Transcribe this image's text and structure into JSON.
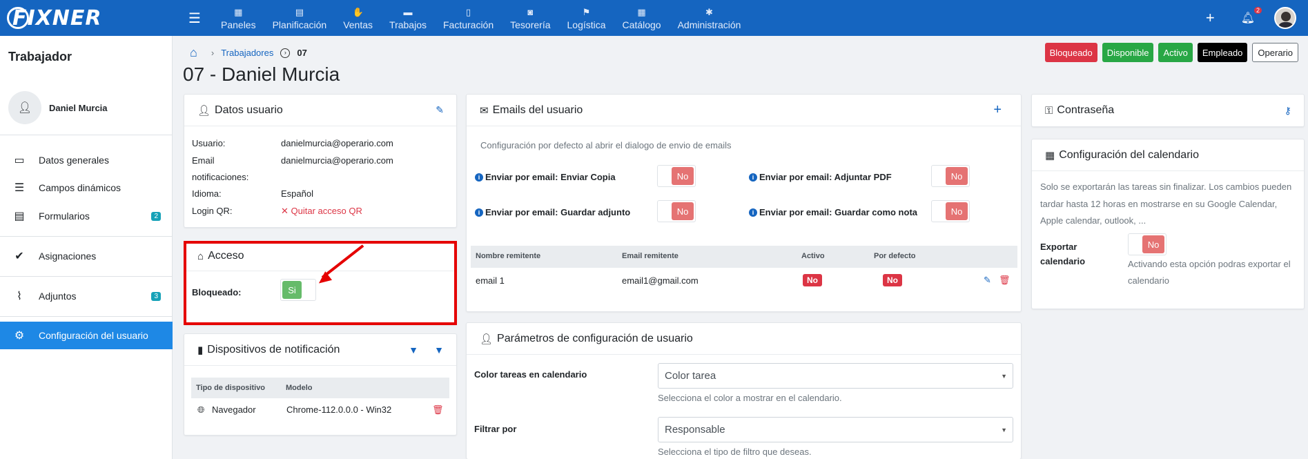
{
  "brand": {
    "logo": "FIXNER"
  },
  "nav": [
    {
      "label": "Paneles",
      "icon": "grid-icon",
      "glyph": "▦"
    },
    {
      "label": "Planificación",
      "icon": "calendar-icon",
      "glyph": "▤"
    },
    {
      "label": "Ventas",
      "icon": "handshake-icon",
      "glyph": "✋"
    },
    {
      "label": "Trabajos",
      "icon": "folder-icon",
      "glyph": "▬"
    },
    {
      "label": "Facturación",
      "icon": "invoice-icon",
      "glyph": "▯"
    },
    {
      "label": "Tesorería",
      "icon": "money-icon",
      "glyph": "◙"
    },
    {
      "label": "Logística",
      "icon": "truck-icon",
      "glyph": "⚑"
    },
    {
      "label": "Catálogo",
      "icon": "catalog-icon",
      "glyph": "▦"
    },
    {
      "label": "Administración",
      "icon": "cog-icon",
      "glyph": "✱"
    }
  ],
  "notifications": {
    "count": "2"
  },
  "sidebar": {
    "title": "Trabajador",
    "user_name": "Daniel Murcia",
    "items": [
      {
        "label": "Datos generales",
        "icon": "id-card-icon",
        "glyph": "▭"
      },
      {
        "label": "Campos dinámicos",
        "icon": "list-icon",
        "glyph": "☰"
      },
      {
        "label": "Formularios",
        "icon": "form-icon",
        "glyph": "▤",
        "badge": "2"
      },
      {
        "label": "Asignaciones",
        "icon": "user-check-icon",
        "glyph": "✔"
      },
      {
        "label": "Adjuntos",
        "icon": "paperclip-icon",
        "glyph": "⌇",
        "badge": "3"
      },
      {
        "label": "Configuración del usuario",
        "icon": "cogs-icon",
        "glyph": "⚙"
      }
    ]
  },
  "breadcrumb": {
    "link": "Trabajadores",
    "current": "07"
  },
  "page_title": "07 - Daniel Murcia",
  "status_buttons": [
    "Bloqueado",
    "Disponible",
    "Activo",
    "Empleado",
    "Operario"
  ],
  "datos_usuario": {
    "title": "Datos usuario",
    "rows": [
      {
        "label": "Usuario:",
        "value": "danielmurcia@operario.com"
      },
      {
        "label": "Email",
        "label2": "notificaciones:",
        "value": "danielmurcia@operario.com"
      },
      {
        "label": "Idioma:",
        "value": "Español"
      },
      {
        "label": "Login QR:",
        "value": "Quitar acceso QR"
      }
    ]
  },
  "acceso": {
    "title": "Acceso",
    "label": "Bloqueado:",
    "toggle": "Si"
  },
  "dispositivos": {
    "title": "Dispositivos de notificación",
    "columns": [
      "Tipo de dispositivo",
      "Modelo"
    ],
    "rows": [
      {
        "tipo": "Navegador",
        "modelo": "Chrome-112.0.0.0 - Win32"
      }
    ]
  },
  "emails": {
    "title": "Emails del usuario",
    "description": "Configuración por defecto al abrir el dialogo de envio de emails",
    "options": [
      {
        "label": "Enviar por email: Enviar Copia",
        "value": "No"
      },
      {
        "label": "Enviar por email: Adjuntar PDF",
        "value": "No"
      },
      {
        "label": "Enviar por email: Guardar adjunto",
        "value": "No"
      },
      {
        "label": "Enviar por email: Guardar como nota",
        "value": "No"
      }
    ],
    "columns": [
      "Nombre remitente",
      "Email remitente",
      "Activo",
      "Por defecto"
    ],
    "rows": [
      {
        "nombre": "email 1",
        "email": "email1@gmail.com",
        "activo": "No",
        "defecto": "No"
      }
    ]
  },
  "parametros": {
    "title": "Parámetros de configuración de usuario",
    "fields": [
      {
        "label": "Color tareas en calendario",
        "value": "Color tarea",
        "help": "Selecciona el color a mostrar en el calendario."
      },
      {
        "label": "Filtrar por",
        "value": "Responsable",
        "help": "Selecciona el tipo de filtro que deseas."
      }
    ]
  },
  "contrasena": {
    "title": "Contraseña"
  },
  "calendario": {
    "title": "Configuración del calendario",
    "desc1": "Solo se exportarán las tareas sin finalizar. Los cambios pueden",
    "desc2": "tardar hasta 12 horas en mostrarse en su Google Calendar,",
    "desc3": "Apple calendar, outlook, ...",
    "label1": "Exportar",
    "label2": "calendario",
    "value": "No",
    "help1": "Activando esta opción podras exportar el",
    "help2": "calendario"
  }
}
